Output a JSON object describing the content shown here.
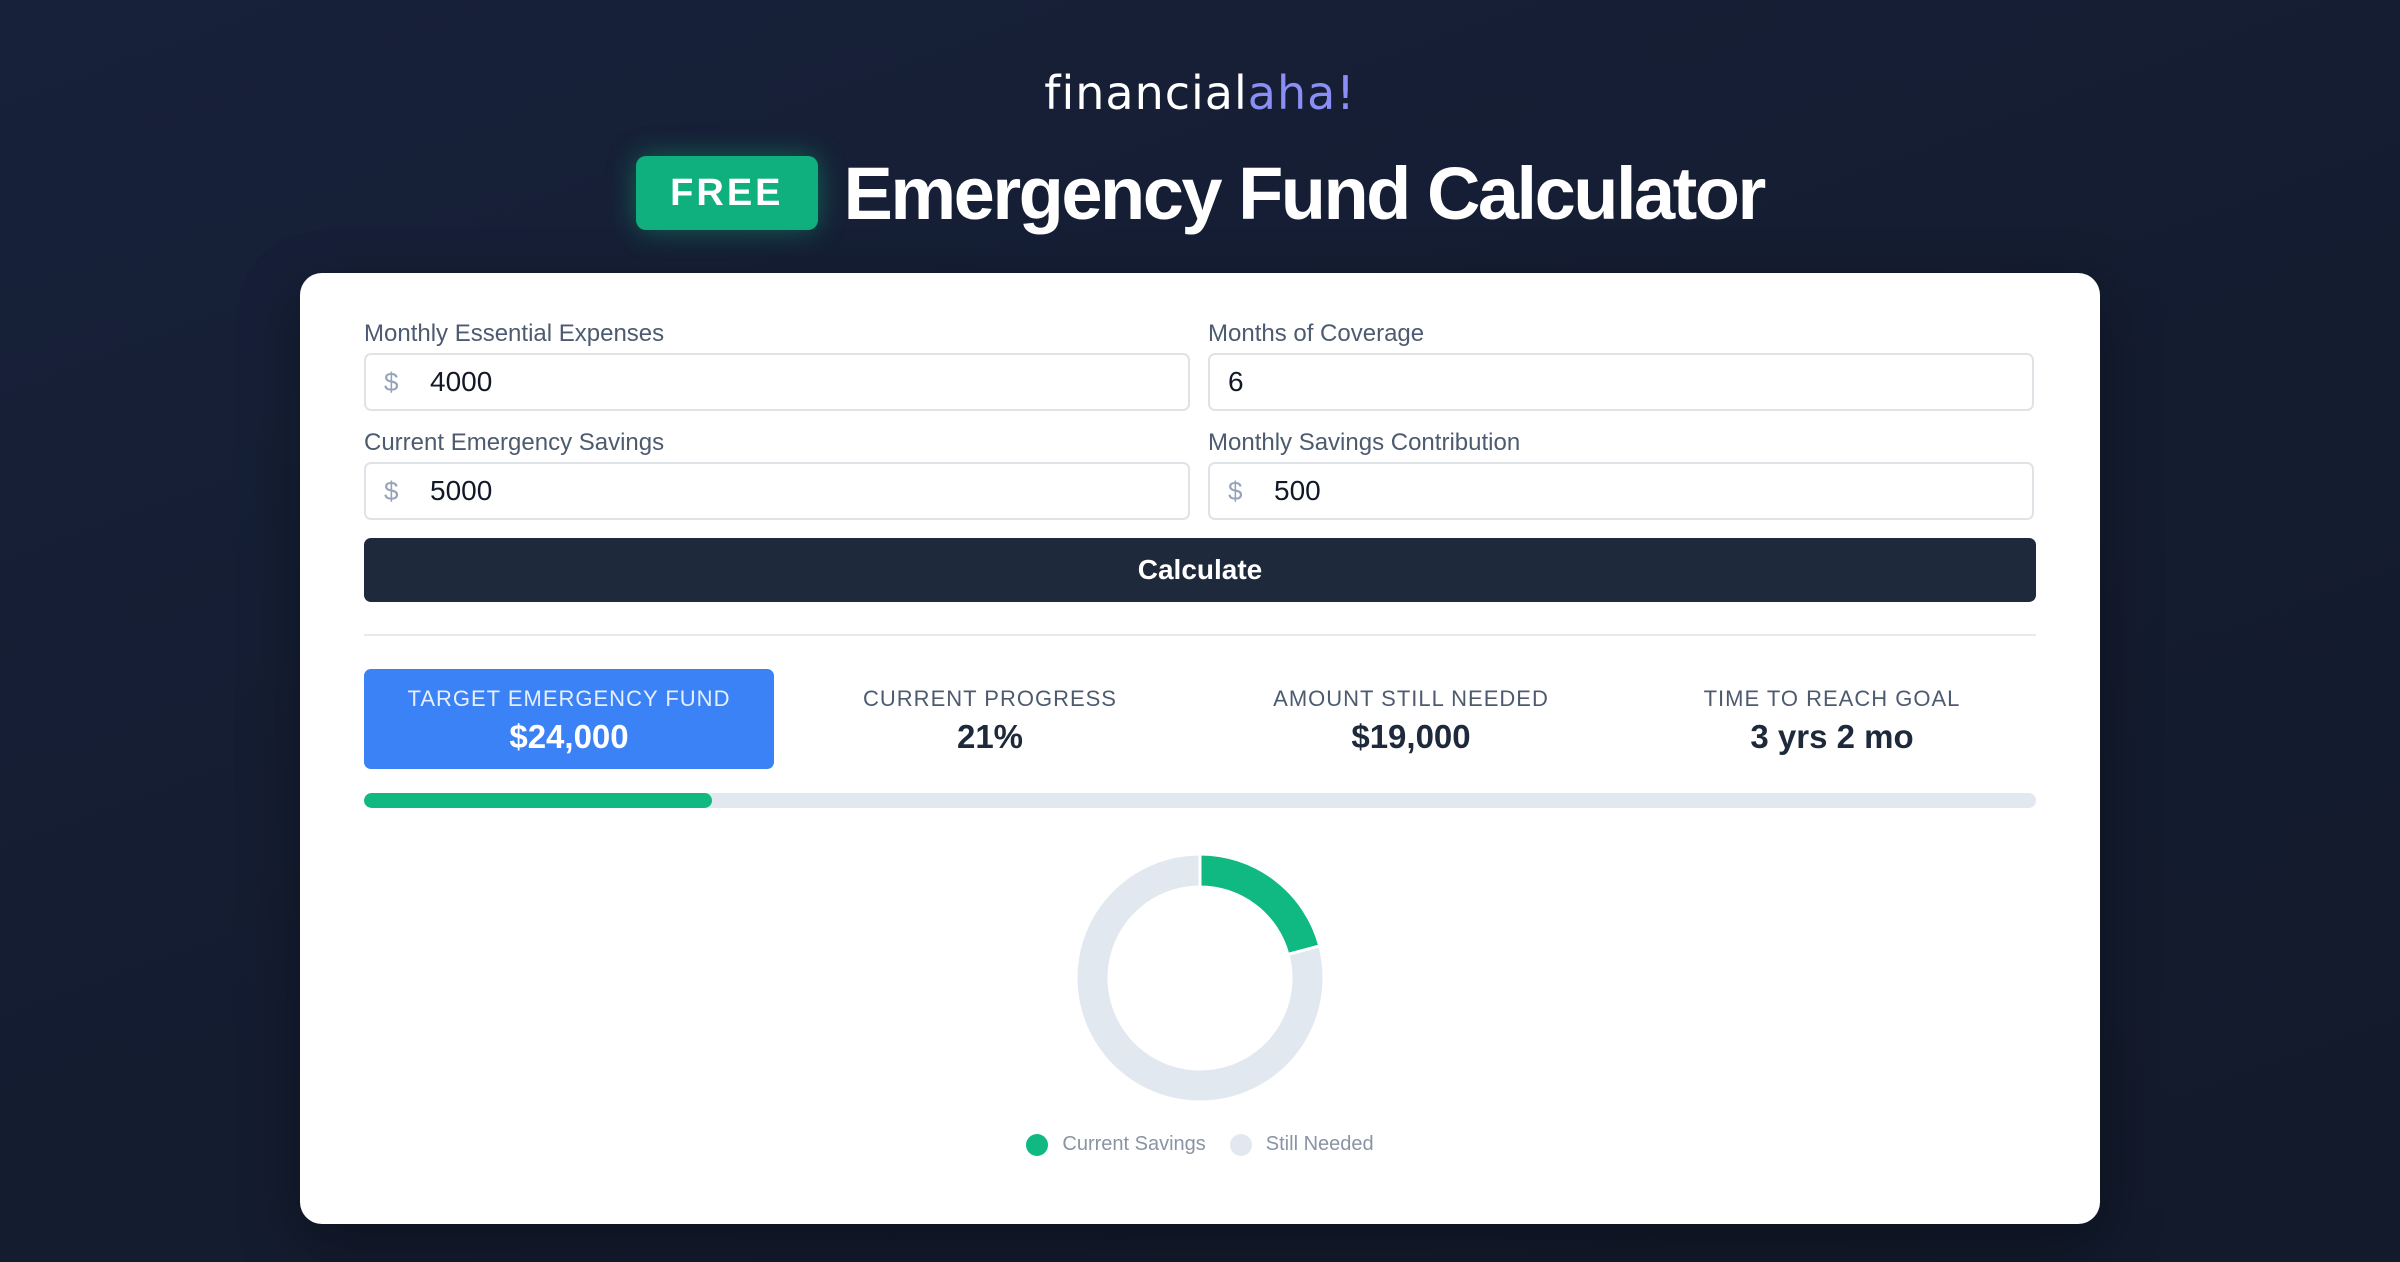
{
  "brand": {
    "name": "financial",
    "accent": "aha!"
  },
  "header": {
    "badge": "FREE",
    "title": "Emergency Fund Calculator"
  },
  "form": {
    "monthly_expenses": {
      "label": "Monthly Essential Expenses",
      "prefix": "$",
      "value": "4000"
    },
    "months_coverage": {
      "label": "Months of Coverage",
      "value": "6"
    },
    "current_savings": {
      "label": "Current Emergency Savings",
      "prefix": "$",
      "value": "5000"
    },
    "monthly_contribution": {
      "label": "Monthly Savings Contribution",
      "prefix": "$",
      "value": "500"
    },
    "calculate_label": "Calculate"
  },
  "results": [
    {
      "label": "TARGET EMERGENCY FUND",
      "value": "$24,000"
    },
    {
      "label": "CURRENT PROGRESS",
      "value": "21%"
    },
    {
      "label": "AMOUNT STILL NEEDED",
      "value": "$19,000"
    },
    {
      "label": "TIME TO REACH GOAL",
      "value": "3 yrs 2 mo"
    }
  ],
  "progress": {
    "fraction": 0.2083
  },
  "chart_data": {
    "type": "pie",
    "categories": [
      "Current Savings",
      "Still Needed"
    ],
    "values": [
      5000,
      19000
    ],
    "colors": [
      "#10b981",
      "#e2e8f0"
    ],
    "legend_position": "bottom"
  },
  "colors": {
    "accent_green": "#10b981",
    "highlight_blue": "#3b82f6",
    "button_dark": "#1e293b",
    "brand_accent": "#8b8ff5"
  }
}
